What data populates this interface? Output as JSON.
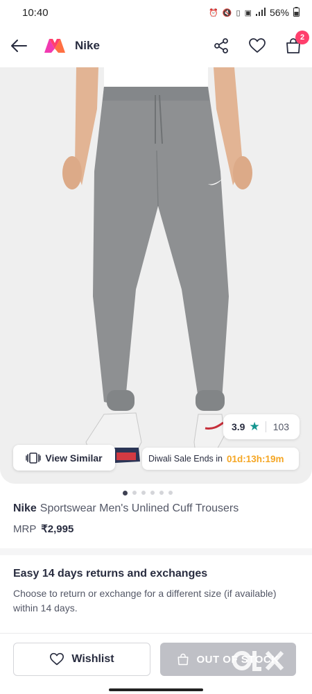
{
  "status_bar": {
    "time": "10:40",
    "icons": [
      "alarm-icon",
      "mute-icon",
      "volte-icon",
      "5g-icon",
      "signal-icon",
      "battery-icon"
    ],
    "battery": "56%"
  },
  "header": {
    "title": "Nike",
    "logo": "myntra-logo",
    "bag_count": "2"
  },
  "product_image": {
    "rating": "3.9",
    "rating_count": "103",
    "view_similar_label": "View Similar",
    "sale_label": "Diwali Sale Ends in",
    "sale_timer": "01d:13h:19m",
    "dots_total": 6,
    "dot_active_index": 0
  },
  "product": {
    "brand": "Nike",
    "name": "Sportswear Men's Unlined Cuff Trousers",
    "mrp_label": "MRP",
    "price": "₹2,995"
  },
  "returns": {
    "title": "Easy 14 days returns and exchanges",
    "text": "Choose to return or exchange for a different size (if available) within 14 days."
  },
  "actions": {
    "wishlist_label": "Wishlist",
    "out_of_stock_label": "OUT OF STOCK"
  },
  "colors": {
    "accent": "#ff3f6c",
    "rating_star": "#14958f",
    "timer": "#f5a623",
    "disabled_button": "#bfc0c6"
  }
}
